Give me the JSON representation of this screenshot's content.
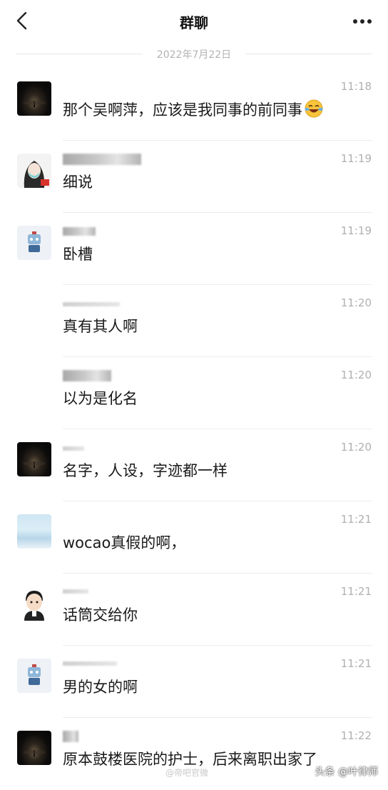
{
  "header": {
    "title": "群聊",
    "back_icon": "chevron-left-icon",
    "more_icon": "ellipsis-icon"
  },
  "date_separator": "2022年7月22日",
  "messages": [
    {
      "avatar": "dark-landscape-avatar",
      "time": "11:18",
      "text": "那个吴啊萍，应该是我同事的前同事",
      "emoji": "laughing-tears-emoji"
    },
    {
      "avatar": "girl-with-mask-avatar",
      "time": "11:19",
      "text": "细说"
    },
    {
      "avatar": "robot-avatar",
      "time": "11:19",
      "text": "卧槽"
    },
    {
      "avatar": "none",
      "time": "11:20",
      "text": "真有其人啊"
    },
    {
      "avatar": "none",
      "time": "11:20",
      "text": "以为是化名"
    },
    {
      "avatar": "dark-landscape-avatar",
      "time": "11:20",
      "text": "名字，人设，字迹都一样"
    },
    {
      "avatar": "water-scene-avatar",
      "time": "11:21",
      "text": "wocao真假的啊，"
    },
    {
      "avatar": "cartoon-boy-avatar",
      "time": "11:21",
      "text": "话筒交给你"
    },
    {
      "avatar": "robot-avatar",
      "time": "11:21",
      "text": "男的女的啊"
    },
    {
      "avatar": "dark-landscape-avatar",
      "time": "11:22",
      "text": "原本鼓楼医院的护士，后来离职出家了"
    }
  ],
  "watermarks": {
    "left": "@帝吧官微",
    "right": "头条 @叶律师"
  }
}
